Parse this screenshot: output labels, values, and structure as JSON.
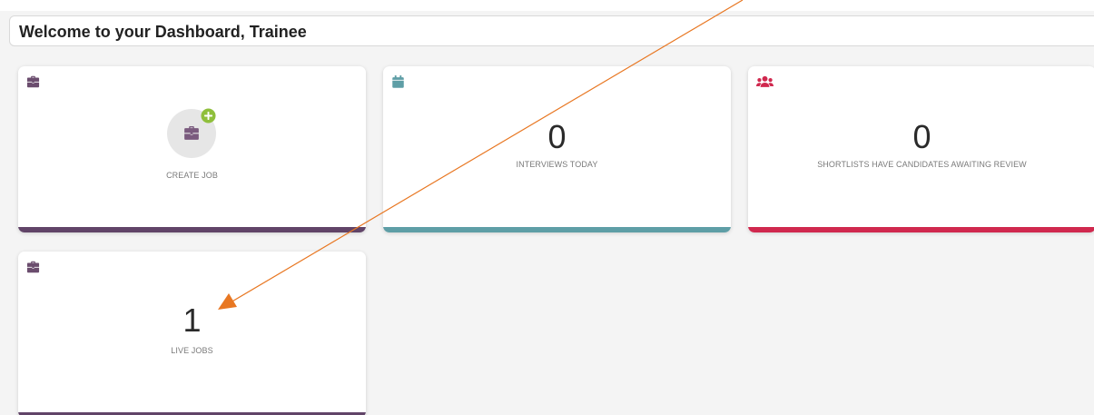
{
  "header": {
    "title": "Welcome to your Dashboard, Trainee"
  },
  "cards": [
    {
      "id": "create-job",
      "icon": "briefcase-icon",
      "label": "CREATE JOB",
      "action_icons": [
        "briefcase-icon",
        "plus-circle-icon"
      ],
      "accent_color": "#614468",
      "icon_color": "#6b4d6e"
    },
    {
      "id": "interviews-today",
      "icon": "calendar-icon",
      "value": "0",
      "label": "INTERVIEWS TODAY",
      "accent_color": "#5e9ea6",
      "icon_color": "#5e9ea6"
    },
    {
      "id": "shortlists-awaiting-review",
      "icon": "users-icon",
      "value": "0",
      "label": "SHORTLISTS HAVE CANDIDATES AWAITING REVIEW",
      "accent_color": "#d0284e",
      "icon_color": "#d0284e"
    },
    {
      "id": "live-jobs",
      "icon": "briefcase-icon",
      "value": "1",
      "label": "LIVE JOBS",
      "accent_color": "#614468",
      "icon_color": "#6b4d6e"
    }
  ],
  "annotation": {
    "type": "arrow",
    "color": "#e87722",
    "points_to": "live-jobs-value"
  },
  "colors": {
    "background": "#f4f4f4",
    "card": "#ffffff",
    "plus_badge": "#8fbf3b"
  }
}
